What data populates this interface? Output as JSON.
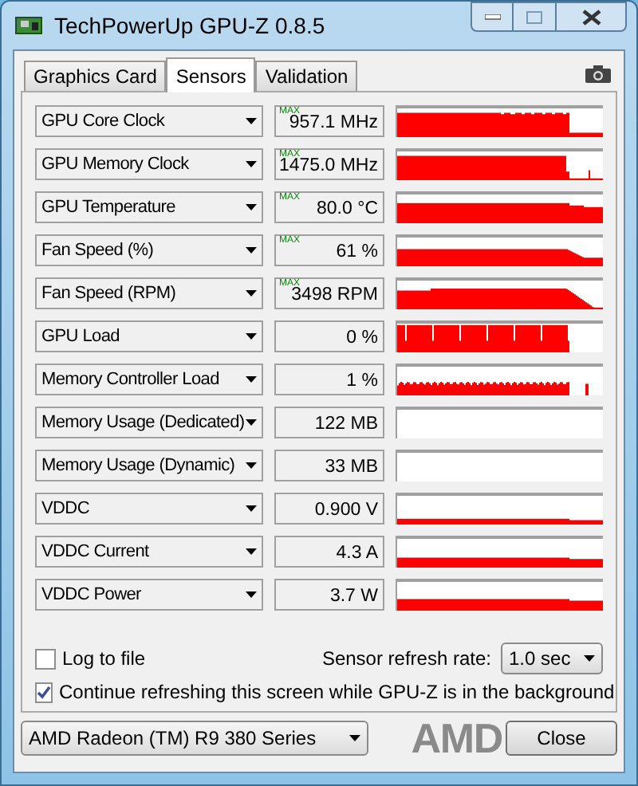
{
  "window": {
    "title": "TechPowerUp GPU-Z 0.8.5"
  },
  "tabs": [
    {
      "label": "Graphics Card",
      "selected": false
    },
    {
      "label": "Sensors",
      "selected": true
    },
    {
      "label": "Validation",
      "selected": false
    }
  ],
  "sensors": [
    {
      "name": "GPU Core Clock",
      "value": "957.1 MHz",
      "marker": "MAX"
    },
    {
      "name": "GPU Memory Clock",
      "value": "1475.0 MHz",
      "marker": "MAX"
    },
    {
      "name": "GPU Temperature",
      "value": "80.0 °C",
      "marker": "MAX"
    },
    {
      "name": "Fan Speed (%)",
      "value": "61 %",
      "marker": "MAX"
    },
    {
      "name": "Fan Speed (RPM)",
      "value": "3498 RPM",
      "marker": "MAX"
    },
    {
      "name": "GPU Load",
      "value": "0 %"
    },
    {
      "name": "Memory Controller Load",
      "value": "1 %"
    },
    {
      "name": "Memory Usage (Dedicated)",
      "value": "122 MB"
    },
    {
      "name": "Memory Usage (Dynamic)",
      "value": "33 MB"
    },
    {
      "name": "VDDC",
      "value": "0.900 V"
    },
    {
      "name": "VDDC Current",
      "value": "4.3 A"
    },
    {
      "name": "VDDC Power",
      "value": "3.7 W"
    }
  ],
  "log_to_file": {
    "label": "Log to file",
    "checked": false
  },
  "refresh_rate": {
    "label": "Sensor refresh rate:",
    "value": "1.0 sec"
  },
  "continue_refreshing": {
    "label": "Continue refreshing this screen while GPU-Z is in the background",
    "checked": true
  },
  "gpu_select": {
    "value": "AMD Radeon (TM) R9 380 Series"
  },
  "logo": "AMD",
  "close_button": "Close"
}
